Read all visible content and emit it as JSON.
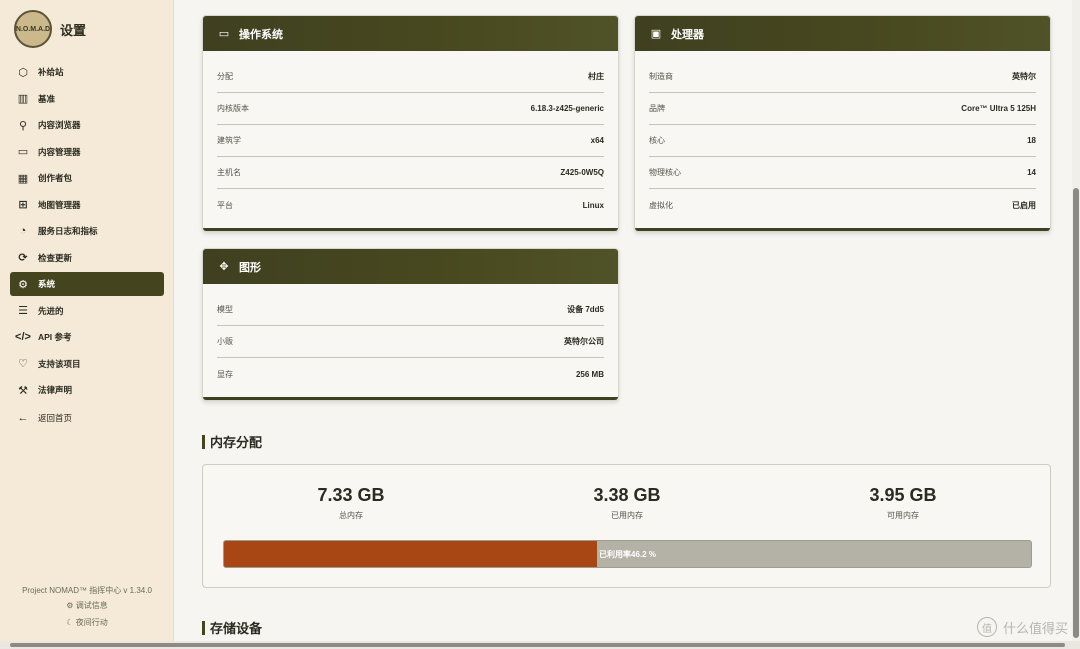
{
  "app": {
    "title": "设置",
    "logo_text": "N.O.M.A.D"
  },
  "sidebar": {
    "items": [
      {
        "label": "补给站",
        "icon": "cube-icon"
      },
      {
        "label": "基准",
        "icon": "bar-chart-icon"
      },
      {
        "label": "内容浏览器",
        "icon": "search-icon"
      },
      {
        "label": "内容管理器",
        "icon": "folder-icon"
      },
      {
        "label": "创作者包",
        "icon": "film-icon"
      },
      {
        "label": "地图管理器",
        "icon": "map-icon"
      },
      {
        "label": "服务日志和指标",
        "icon": "gauge-icon"
      },
      {
        "label": "检查更新",
        "icon": "refresh-icon"
      },
      {
        "label": "系统",
        "icon": "gear-icon",
        "active": true
      },
      {
        "label": "先进的",
        "icon": "sliders-icon"
      },
      {
        "label": "API 参考",
        "icon": "code-icon"
      },
      {
        "label": "支持该项目",
        "icon": "heart-icon"
      },
      {
        "label": "法律声明",
        "icon": "gavel-icon"
      }
    ],
    "back": "返回首页",
    "version": "Project NOMAD™ 指挥中心 v 1.34.0",
    "debug": "调试信息",
    "night": "夜间行动"
  },
  "os_card": {
    "title": "操作系统",
    "rows": [
      {
        "k": "分配",
        "v": "村庄"
      },
      {
        "k": "内核版本",
        "v": "6.18.3-z425-generic"
      },
      {
        "k": "建筑学",
        "v": "x64"
      },
      {
        "k": "主机名",
        "v": "Z425-0W5Q"
      },
      {
        "k": "平台",
        "v": "Linux"
      }
    ]
  },
  "cpu_card": {
    "title": "处理器",
    "rows": [
      {
        "k": "制造商",
        "v": "英特尔"
      },
      {
        "k": "品牌",
        "v": "Core™ Ultra 5 125H"
      },
      {
        "k": "核心",
        "v": "18"
      },
      {
        "k": "物理核心",
        "v": "14"
      },
      {
        "k": "虚拟化",
        "v": "已启用"
      }
    ]
  },
  "gpu_card": {
    "title": "图形",
    "rows": [
      {
        "k": "模型",
        "v": "设备 7dd5"
      },
      {
        "k": "小贩",
        "v": "英特尔公司"
      },
      {
        "k": "显存",
        "v": "256 MB"
      }
    ]
  },
  "memory": {
    "title": "内存分配",
    "total": {
      "value": "7.33 GB",
      "label": "总内存"
    },
    "used": {
      "value": "3.38 GB",
      "label": "已用内存"
    },
    "free": {
      "value": "3.95 GB",
      "label": "可用内存"
    },
    "usage_percent": 46.2,
    "usage_text": "已利用率46.2 %"
  },
  "storage": {
    "title": "存储设备"
  },
  "watermark": "什么值得买",
  "colors": {
    "accent": "#44451f",
    "progress_fill": "#a84713",
    "progress_track": "#b4b2a6",
    "sidebar_bg": "#f4ead7"
  }
}
